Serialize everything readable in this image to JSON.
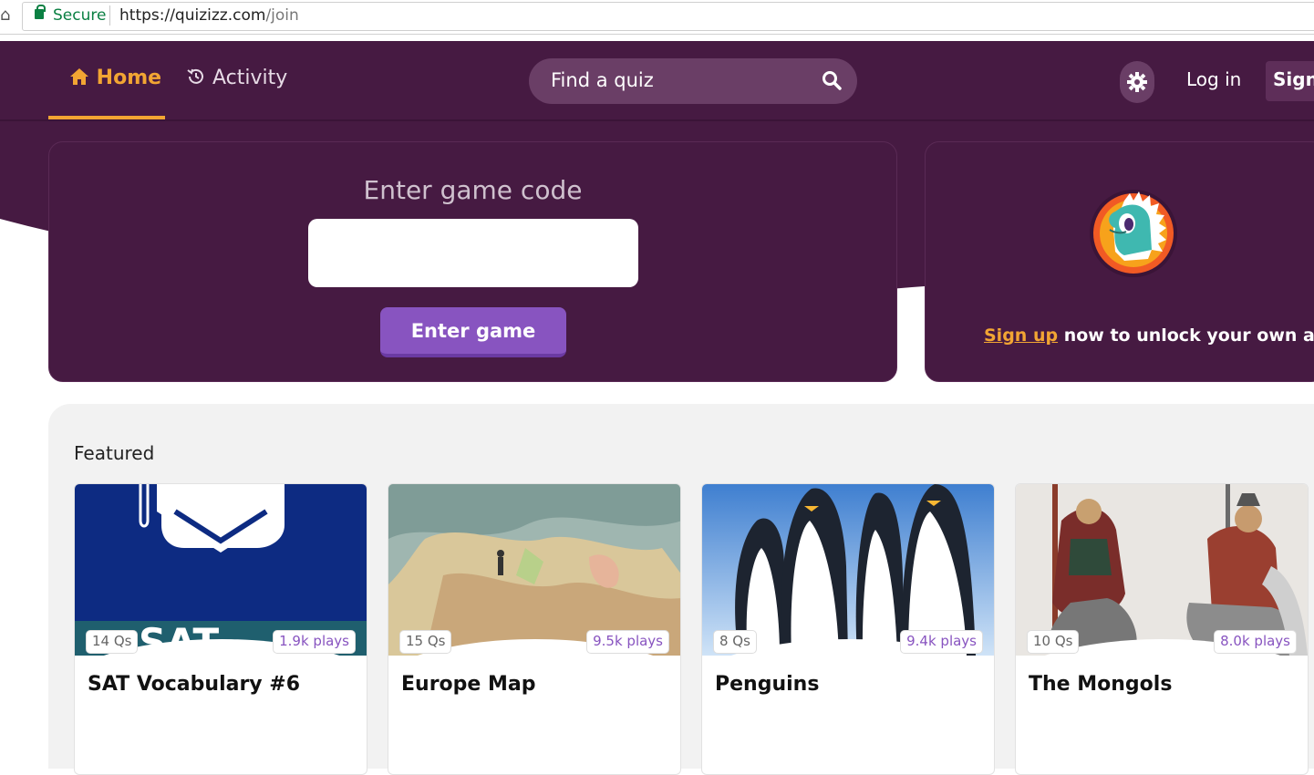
{
  "browser": {
    "secure_label": "Secure",
    "url_base": "https://quizizz.com",
    "url_path": "/join"
  },
  "nav": {
    "home_label": "Home",
    "activity_label": "Activity",
    "search_placeholder": "Find a quiz",
    "login_label": "Log in",
    "signup_label": "Sign up"
  },
  "join": {
    "title": "Enter game code",
    "input_value": "",
    "button_label": "Enter game"
  },
  "avatar_panel": {
    "signup_link": "Sign up",
    "text": " now to unlock your own avatar"
  },
  "featured": {
    "title": "Featured",
    "cards": [
      {
        "title": "SAT Vocabulary #6",
        "questions": "14 Qs",
        "plays": "1.9k plays"
      },
      {
        "title": "Europe Map",
        "questions": "15 Qs",
        "plays": "9.5k plays"
      },
      {
        "title": "Penguins",
        "questions": "8 Qs",
        "plays": "9.4k plays"
      },
      {
        "title": "The Mongols",
        "questions": "10 Qs",
        "plays": "8.0k plays"
      }
    ]
  },
  "colors": {
    "header_bg": "#461a42",
    "accent": "#f2a533",
    "button": "#8854c0"
  }
}
